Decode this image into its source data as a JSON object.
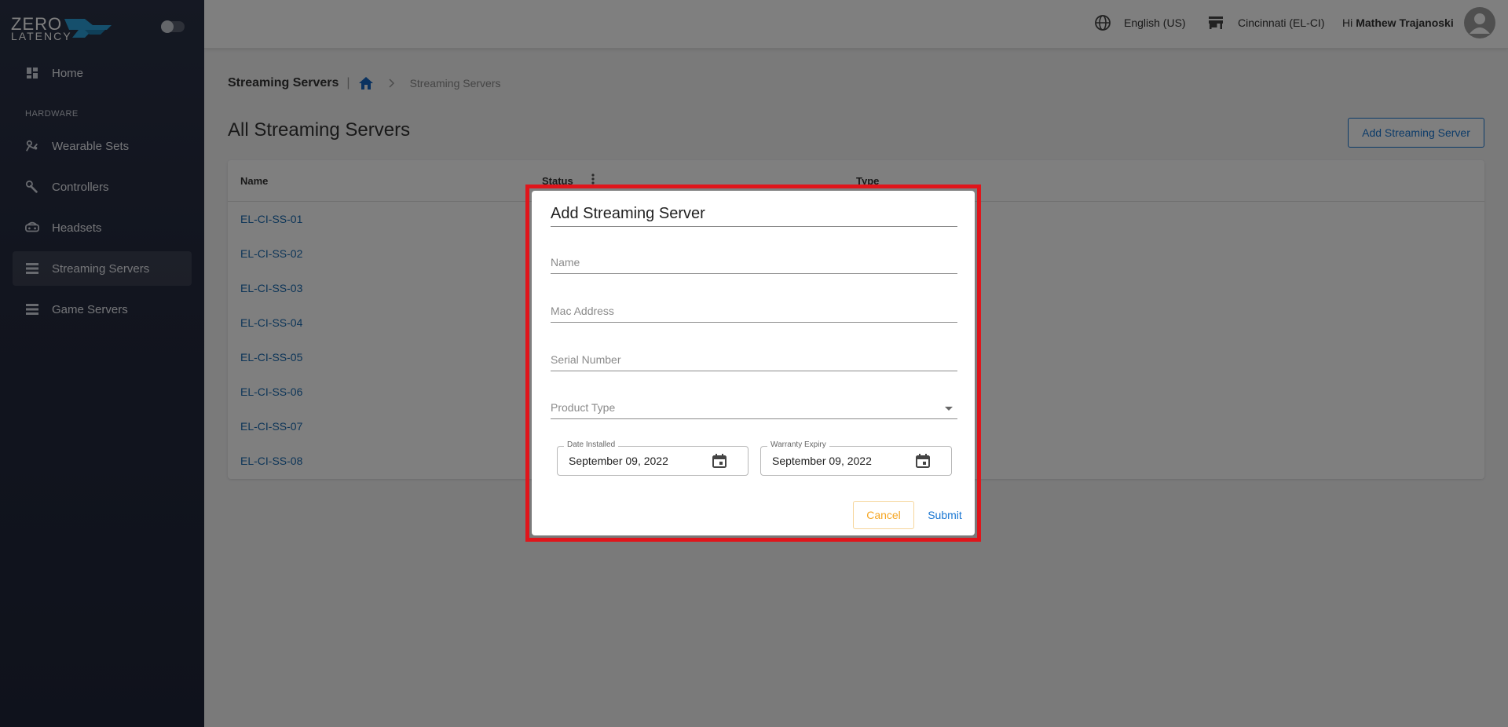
{
  "app": {
    "logo_line1": "ZERO",
    "logo_line2": "LATENCY",
    "accent": "#2a9fd8"
  },
  "sidebar": {
    "section_label": "HARDWARE",
    "items": [
      {
        "label": "Home",
        "icon": "dashboard-icon"
      },
      {
        "label": "Wearable Sets",
        "icon": "wearable-icon"
      },
      {
        "label": "Controllers",
        "icon": "controller-icon"
      },
      {
        "label": "Headsets",
        "icon": "headset-icon"
      },
      {
        "label": "Streaming Servers",
        "icon": "server-icon",
        "active": true
      },
      {
        "label": "Game Servers",
        "icon": "server-icon"
      }
    ]
  },
  "topbar": {
    "language": "English (US)",
    "location": "Cincinnati (EL-CI)",
    "greeting": "Hi",
    "user_name": "Mathew Trajanoski"
  },
  "breadcrumb": {
    "title": "Streaming Servers",
    "current": "Streaming Servers"
  },
  "page": {
    "title": "All Streaming Servers",
    "add_button": "Add Streaming Server"
  },
  "table": {
    "columns": [
      "Name",
      "Status",
      "Type"
    ],
    "rows": [
      "EL-CI-SS-01",
      "EL-CI-SS-02",
      "EL-CI-SS-03",
      "EL-CI-SS-04",
      "EL-CI-SS-05",
      "EL-CI-SS-06",
      "EL-CI-SS-07",
      "EL-CI-SS-08"
    ]
  },
  "dialog": {
    "title": "Add Streaming Server",
    "name_placeholder": "Name",
    "mac_placeholder": "Mac Address",
    "serial_placeholder": "Serial Number",
    "product_type_placeholder": "Product Type",
    "date_installed_label": "Date Installed",
    "date_installed_value": "September 09, 2022",
    "warranty_label": "Warranty Expiry",
    "warranty_value": "September 09, 2022",
    "cancel": "Cancel",
    "submit": "Submit"
  }
}
